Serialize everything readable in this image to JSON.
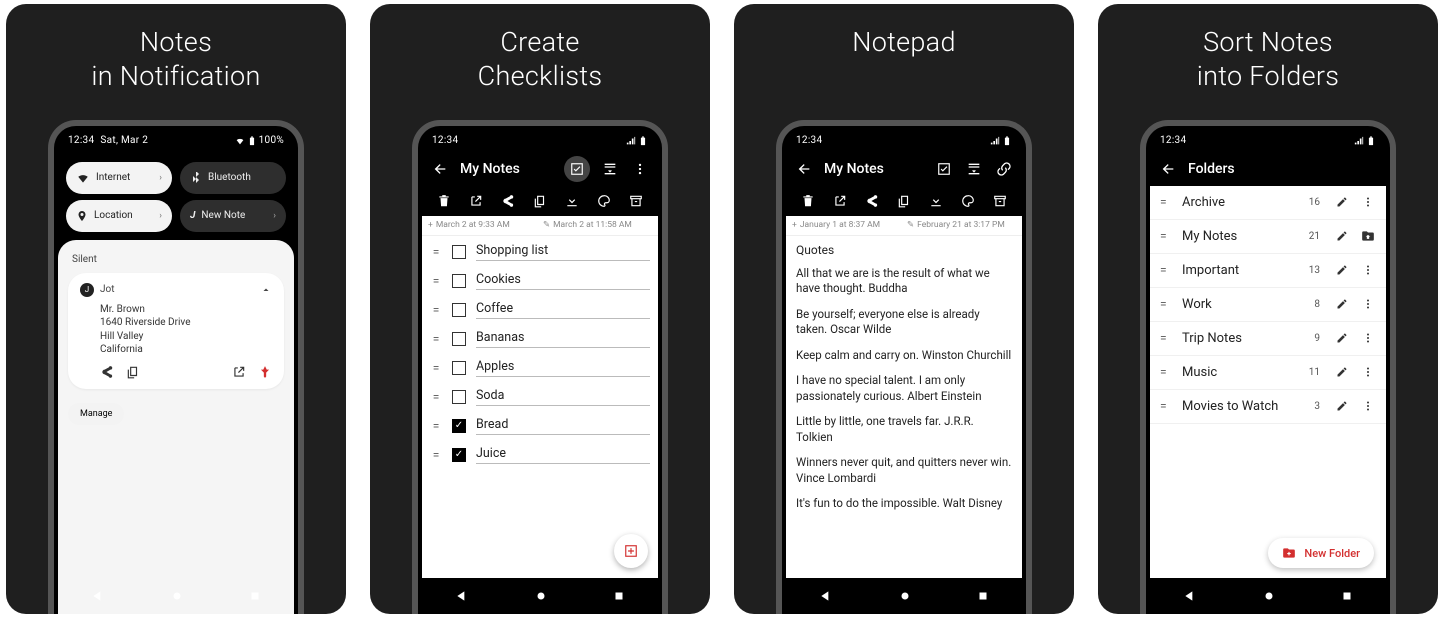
{
  "panels": [
    {
      "title_line1": "Notes",
      "title_line2": "in Notification"
    },
    {
      "title_line1": "Create",
      "title_line2": "Checklists"
    },
    {
      "title_line1": "Notepad",
      "title_line2": ""
    },
    {
      "title_line1": "Sort Notes",
      "title_line2": "into Folders"
    }
  ],
  "status": {
    "time": "12:34",
    "date": "Sat, Mar 2",
    "battery": "100%"
  },
  "p1": {
    "qs": {
      "internet": "Internet",
      "bluetooth": "Bluetooth",
      "location": "Location",
      "newnote": "New Note"
    },
    "silent": "Silent",
    "notif": {
      "app": "Jot",
      "line1": "Mr. Brown",
      "line2": "1640 Riverside Drive",
      "line3": "Hill Valley",
      "line4": "California",
      "manage": "Manage"
    }
  },
  "p2": {
    "title": "My Notes",
    "created": "March 2 at 9:33 AM",
    "modified": "March 2 at 11:58 AM",
    "items": [
      {
        "label": "Shopping list",
        "checked": false
      },
      {
        "label": "Cookies",
        "checked": false
      },
      {
        "label": "Coffee",
        "checked": false
      },
      {
        "label": "Bananas",
        "checked": false
      },
      {
        "label": "Apples",
        "checked": false
      },
      {
        "label": "Soda",
        "checked": false
      },
      {
        "label": "Bread",
        "checked": true
      },
      {
        "label": "Juice",
        "checked": true
      }
    ]
  },
  "p3": {
    "title": "My Notes",
    "created": "January 1 at 8:37 AM",
    "modified": "February 21 at 3:17 PM",
    "heading": "Quotes",
    "paras": [
      "All that we are is the result of what we have thought. Buddha",
      "Be yourself; everyone else is already taken. Oscar Wilde",
      "Keep calm and carry on. Winston Churchill",
      "I have no special talent. I am only passionately curious. Albert Einstein",
      "Little by little, one travels far. J.R.R. Tolkien",
      "Winners never quit, and quitters never win. Vince Lombardi",
      "It's fun to do the impossible. Walt Disney"
    ]
  },
  "p4": {
    "title": "Folders",
    "folders": [
      {
        "name": "Archive",
        "count": 16,
        "home": false
      },
      {
        "name": "My Notes",
        "count": 21,
        "home": true
      },
      {
        "name": "Important",
        "count": 13,
        "home": false
      },
      {
        "name": "Work",
        "count": 8,
        "home": false
      },
      {
        "name": "Trip Notes",
        "count": 9,
        "home": false
      },
      {
        "name": "Music",
        "count": 11,
        "home": false
      },
      {
        "name": "Movies to Watch",
        "count": 3,
        "home": false
      }
    ],
    "new_folder": "New Folder"
  }
}
